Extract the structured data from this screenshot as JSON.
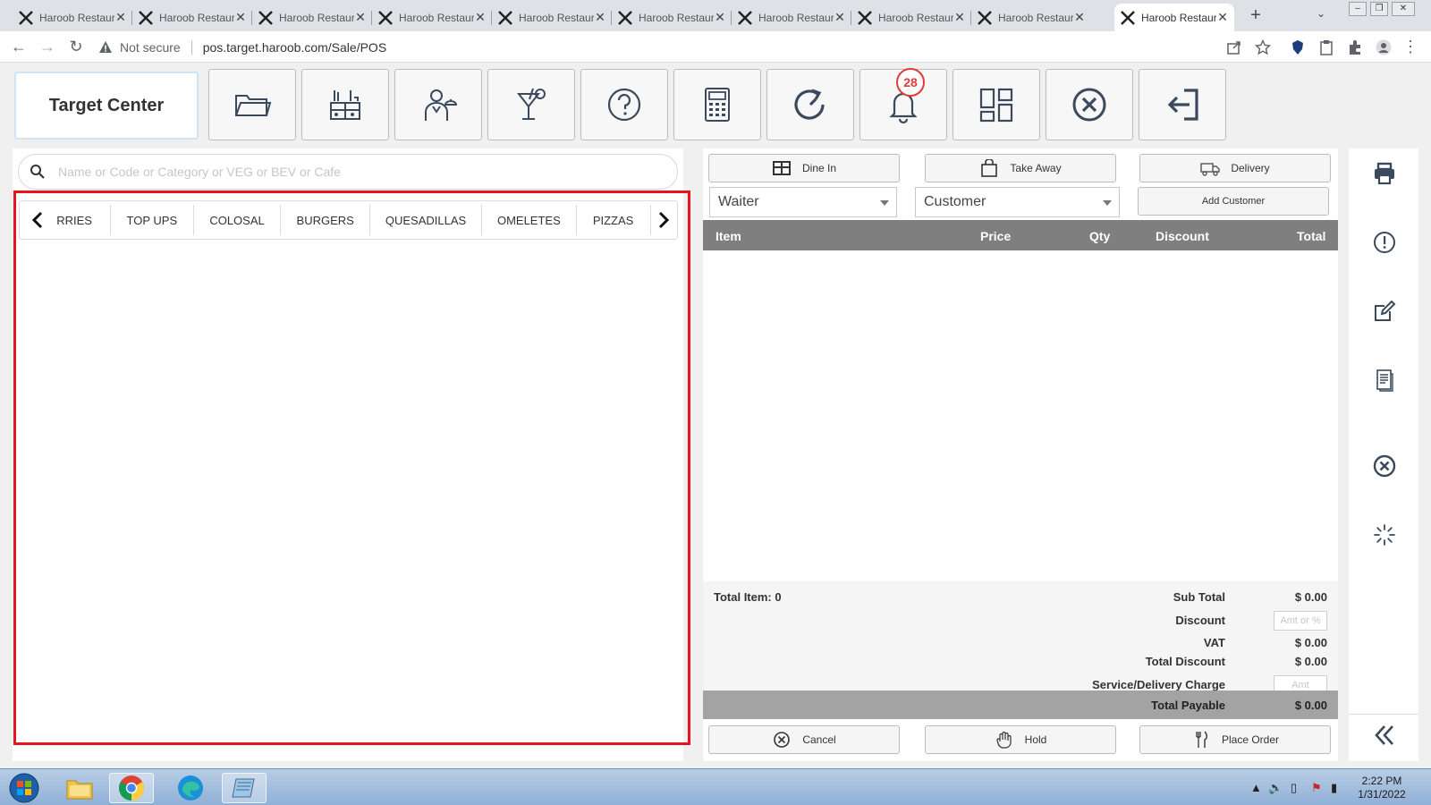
{
  "browser": {
    "tabs": [
      {
        "title": "Haroob Restaurant",
        "active": false
      },
      {
        "title": "Haroob Restaurant",
        "active": false
      },
      {
        "title": "Haroob Restaurant",
        "active": false
      },
      {
        "title": "Haroob Restaurant",
        "active": false
      },
      {
        "title": "Haroob Restaurant",
        "active": false
      },
      {
        "title": "Haroob Restaurant",
        "active": false
      },
      {
        "title": "Haroob Restaurant",
        "active": false
      },
      {
        "title": "Haroob Restaurant",
        "active": false
      },
      {
        "title": "Haroob Restaurant",
        "active": false
      },
      {
        "title": "Haroob Restaurant",
        "active": true
      }
    ],
    "security_text": "Not secure",
    "url": "pos.target.haroob.com/Sale/POS"
  },
  "app": {
    "brand": "Target Center",
    "notification_count": "28"
  },
  "search": {
    "placeholder": "Name or Code or Category or VEG or BEV or Cafe"
  },
  "categories": [
    "RRIES",
    "TOP UPS",
    "COLOSAL",
    "BURGERS",
    "QUESADILLAS",
    "OMELETES",
    "PIZZAS"
  ],
  "order": {
    "dine_in": "Dine In",
    "take_away": "Take Away",
    "delivery": "Delivery",
    "waiter": "Waiter",
    "customer": "Customer",
    "add_customer": "Add Customer",
    "columns": {
      "item": "Item",
      "price": "Price",
      "qty": "Qty",
      "discount": "Discount",
      "total": "Total"
    },
    "total_item": "Total Item: 0",
    "sub_total_label": "Sub Total",
    "sub_total": "$ 0.00",
    "discount_label": "Discount",
    "discount_placeholder": "Amt or %",
    "vat_label": "VAT",
    "vat": "$ 0.00",
    "total_discount_label": "Total Discount",
    "total_discount": "$ 0.00",
    "service_label": "Service/Delivery Charge",
    "service_placeholder": "Amt",
    "payable_label": "Total Payable",
    "payable": "$ 0.00",
    "cancel": "Cancel",
    "hold": "Hold",
    "place_order": "Place Order"
  },
  "taskbar": {
    "time": "2:22 PM",
    "date": "1/31/2022"
  },
  "colors": {
    "highlight": "#e8141c",
    "badge": "#e53935",
    "table_header": "#7f7f7f",
    "icon": "#3a4a5c"
  }
}
